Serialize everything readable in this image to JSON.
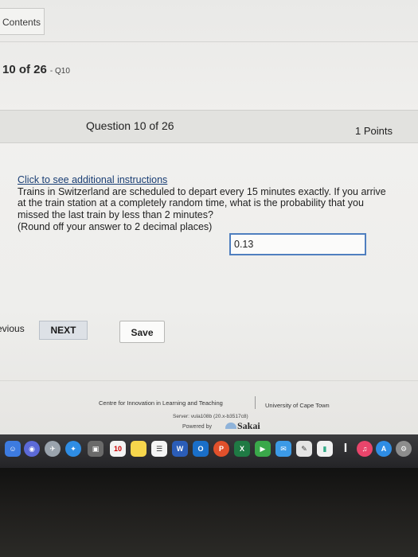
{
  "nav": {
    "contents_label": "Contents"
  },
  "progress": {
    "title": "10 of 26",
    "question_code": "- Q10"
  },
  "question": {
    "header": "Question 10 of 26",
    "points": "1 Points",
    "instructions_link": "Click to see additional instructions",
    "text": "Trains in Switzerland are scheduled to depart every 15 minutes exactly. If you arrive at the train station at a completely random time, what is the probability that you missed the last train by less than 2 minutes?",
    "answer_prompt": "(Round off your answer to 2 decimal places)",
    "answer_value": "0.13"
  },
  "buttons": {
    "previous_label": "evious",
    "next_label": "NEXT",
    "save_label": "Save"
  },
  "footer": {
    "centre": "Centre for Innovation in Learning and Teaching",
    "university": "University of Cape Town",
    "server": "Server: vula108b (20.x-b3517c8)",
    "powered_by": "Powered by",
    "sakai": "Sakai"
  },
  "dock": {
    "calendar_day": "10",
    "word_label": "W",
    "excel_label": "X",
    "powerpoint_label": "P",
    "outlook_label": "O",
    "colors": {
      "finder": "#3d7be0",
      "safari": "#2f8de4",
      "word": "#2b5db8",
      "excel": "#1f7a44",
      "powerpoint": "#d24726",
      "outlook": "#1a6fc9",
      "music": "#e9456b",
      "appstore": "#2f8de4"
    }
  }
}
